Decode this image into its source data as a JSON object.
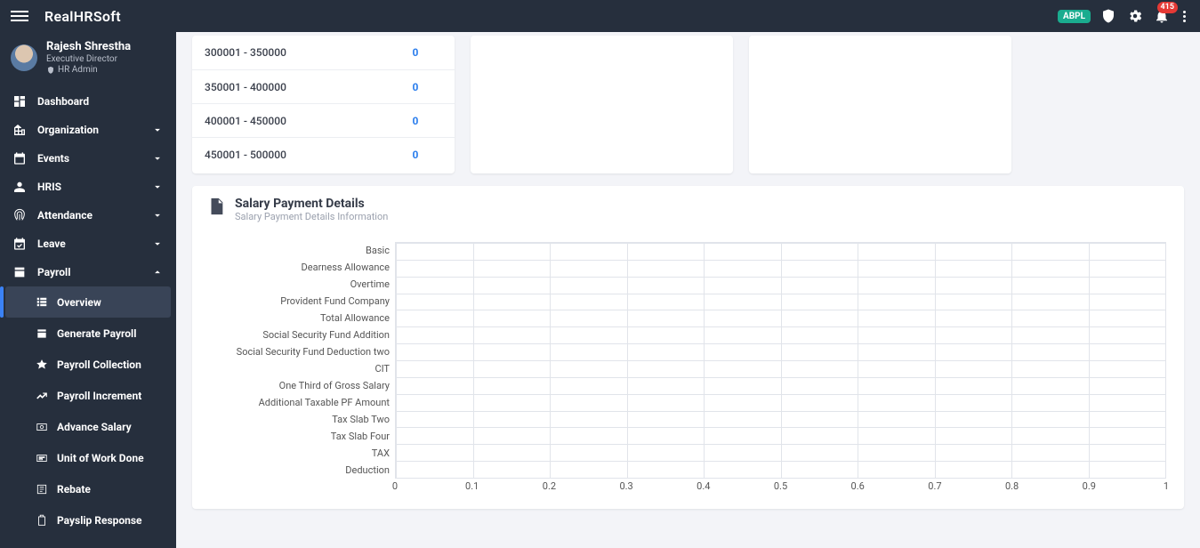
{
  "header": {
    "brand": "RealHRSoft",
    "org_badge": "ABPL",
    "noti_count": "415"
  },
  "user": {
    "name": "Rajesh Shrestha",
    "role": "Executive Director",
    "admin": "HR Admin"
  },
  "nav": {
    "dashboard": "Dashboard",
    "organization": "Organization",
    "events": "Events",
    "hris": "HRIS",
    "attendance": "Attendance",
    "leave": "Leave",
    "payroll": "Payroll",
    "payroll_sub": {
      "overview": "Overview",
      "generate": "Generate Payroll",
      "collection": "Payroll Collection",
      "increment": "Payroll Increment",
      "advance": "Advance Salary",
      "uow": "Unit of Work Done",
      "rebate": "Rebate",
      "payslip": "Payslip Response"
    }
  },
  "ranges": [
    {
      "label": "300001 - 350000",
      "value": "0"
    },
    {
      "label": "350001 - 400000",
      "value": "0"
    },
    {
      "label": "400001 - 450000",
      "value": "0"
    },
    {
      "label": "450001 - 500000",
      "value": "0"
    }
  ],
  "details": {
    "title": "Salary Payment Details",
    "subtitle": "Salary Payment Details Information"
  },
  "chart_data": {
    "type": "bar",
    "orientation": "horizontal",
    "title": "Salary Payment Details",
    "categories": [
      "Basic",
      "Dearness Allowance",
      "Overtime",
      "Provident Fund Company",
      "Total Allowance",
      "Social Security Fund Addition",
      "Social Security Fund Deduction two",
      "CIT",
      "One Third of Gross Salary",
      "Additional Taxable PF Amount",
      "Tax Slab Two",
      "Tax Slab Four",
      "TAX",
      "Deduction"
    ],
    "values": [
      0,
      0,
      0,
      0,
      0,
      0,
      0,
      0,
      0,
      0,
      0,
      0,
      0,
      0
    ],
    "xlabel": "",
    "ylabel": "",
    "xlim": [
      0,
      1.0
    ],
    "x_ticks": [
      0,
      0.1,
      0.2,
      0.3,
      0.4,
      0.5,
      0.6,
      0.7,
      0.8,
      0.9,
      1.0
    ]
  }
}
